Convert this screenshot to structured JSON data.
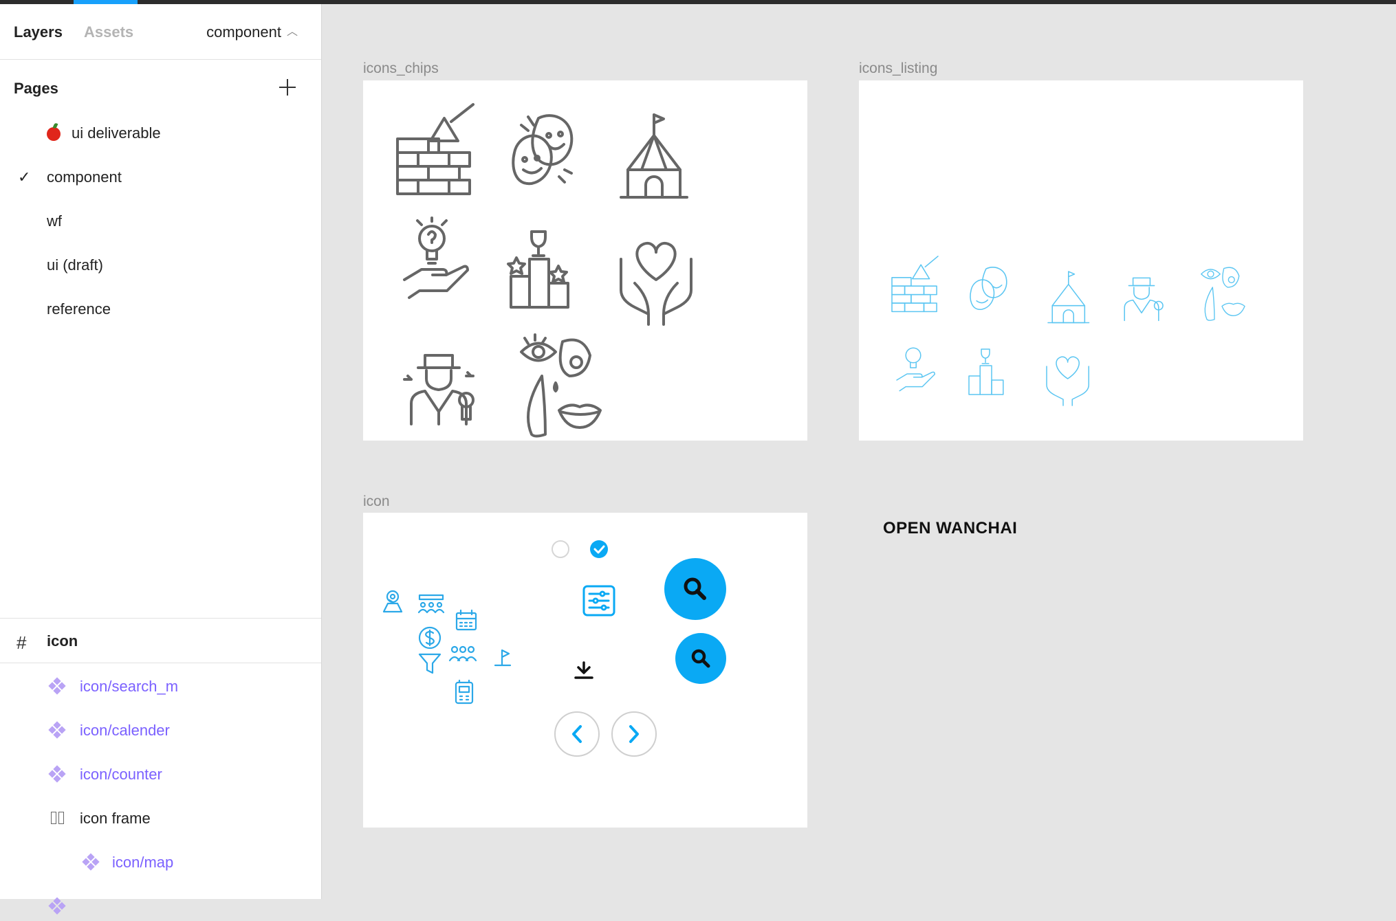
{
  "tabs": {
    "layers": "Layers",
    "assets": "Assets",
    "current_page": "component"
  },
  "pages": {
    "heading": "Pages",
    "items": [
      {
        "label": "ui deliverable",
        "emoji": "apple"
      },
      {
        "label": "component",
        "selected": true
      },
      {
        "label": "wf"
      },
      {
        "label": "ui (draft)"
      },
      {
        "label": "reference"
      }
    ]
  },
  "layers": {
    "frame": "icon",
    "items": [
      {
        "label": "icon/search_m",
        "type": "component"
      },
      {
        "label": "icon/calender",
        "type": "component"
      },
      {
        "label": "icon/counter",
        "type": "component"
      },
      {
        "label": "icon frame",
        "type": "frame"
      },
      {
        "label": "icon/map",
        "type": "component"
      }
    ]
  },
  "canvas": {
    "frames": [
      "icons_chips",
      "icons_listing",
      "icon"
    ],
    "text": "OPEN WANCHAI"
  },
  "colors": {
    "accent": "#18a0fb",
    "icon_gray": "#666666",
    "icon_blue": "#5cc6f2",
    "button_blue": "#0aa9f4",
    "component_purple": "#7b61ff"
  }
}
